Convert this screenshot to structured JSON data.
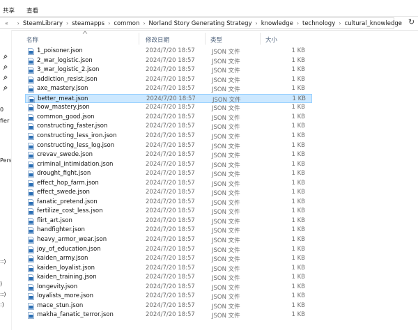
{
  "ribbon": {
    "tabs": [
      "共享",
      "查看"
    ]
  },
  "address": {
    "crumbs": [
      "SteamLibrary",
      "steamapps",
      "common",
      "Norland Story Generating Strategy",
      "knowledge",
      "technology",
      "cultural_knowledge"
    ],
    "lead_glyph": "«",
    "sep_glyph": "›",
    "dropdown_glyph": "⌄",
    "refresh_glyph": "↻"
  },
  "nav_fragments": [
    "0",
    "fier",
    "Perso",
    "::)",
    ")",
    "::)",
    ":)"
  ],
  "columns": {
    "name": "名称",
    "date": "修改日期",
    "type": "类型",
    "size": "大小"
  },
  "files": [
    {
      "name": "1_poisoner.json",
      "date": "2024/7/20 18:57",
      "type": "JSON 文件",
      "size": "1 KB"
    },
    {
      "name": "2_war_logistic.json",
      "date": "2024/7/20 18:57",
      "type": "JSON 文件",
      "size": "1 KB"
    },
    {
      "name": "3_war_logistic_2.json",
      "date": "2024/7/20 18:57",
      "type": "JSON 文件",
      "size": "1 KB"
    },
    {
      "name": "addiction_resist.json",
      "date": "2024/7/20 18:57",
      "type": "JSON 文件",
      "size": "1 KB"
    },
    {
      "name": "axe_mastery.json",
      "date": "2024/7/20 18:57",
      "type": "JSON 文件",
      "size": "1 KB"
    },
    {
      "name": "better_meat.json",
      "date": "2024/7/20 18:57",
      "type": "JSON 文件",
      "size": "1 KB",
      "selected": true
    },
    {
      "name": "bow_mastery.json",
      "date": "2024/7/20 18:57",
      "type": "JSON 文件",
      "size": "1 KB"
    },
    {
      "name": "common_good.json",
      "date": "2024/7/20 18:57",
      "type": "JSON 文件",
      "size": "1 KB"
    },
    {
      "name": "constructing_faster.json",
      "date": "2024/7/20 18:57",
      "type": "JSON 文件",
      "size": "1 KB"
    },
    {
      "name": "constructing_less_iron.json",
      "date": "2024/7/20 18:57",
      "type": "JSON 文件",
      "size": "1 KB"
    },
    {
      "name": "constructing_less_log.json",
      "date": "2024/7/20 18:57",
      "type": "JSON 文件",
      "size": "1 KB"
    },
    {
      "name": "crevav_swede.json",
      "date": "2024/7/20 18:57",
      "type": "JSON 文件",
      "size": "1 KB"
    },
    {
      "name": "criminal_intimidation.json",
      "date": "2024/7/20 18:57",
      "type": "JSON 文件",
      "size": "1 KB"
    },
    {
      "name": "drought_fight.json",
      "date": "2024/7/20 18:57",
      "type": "JSON 文件",
      "size": "1 KB"
    },
    {
      "name": "effect_hop_farm.json",
      "date": "2024/7/20 18:57",
      "type": "JSON 文件",
      "size": "1 KB"
    },
    {
      "name": "effect_swede.json",
      "date": "2024/7/20 18:57",
      "type": "JSON 文件",
      "size": "1 KB"
    },
    {
      "name": "fanatic_pretend.json",
      "date": "2024/7/20 18:57",
      "type": "JSON 文件",
      "size": "1 KB"
    },
    {
      "name": "fertilize_cost_less.json",
      "date": "2024/7/20 18:57",
      "type": "JSON 文件",
      "size": "1 KB"
    },
    {
      "name": "flirt_art.json",
      "date": "2024/7/20 18:57",
      "type": "JSON 文件",
      "size": "1 KB"
    },
    {
      "name": "handfighter.json",
      "date": "2024/7/20 18:57",
      "type": "JSON 文件",
      "size": "1 KB"
    },
    {
      "name": "heavy_armor_wear.json",
      "date": "2024/7/20 18:57",
      "type": "JSON 文件",
      "size": "1 KB"
    },
    {
      "name": "joy_of_education.json",
      "date": "2024/7/20 18:57",
      "type": "JSON 文件",
      "size": "1 KB"
    },
    {
      "name": "kaiden_army.json",
      "date": "2024/7/20 18:57",
      "type": "JSON 文件",
      "size": "1 KB"
    },
    {
      "name": "kaiden_loyalist.json",
      "date": "2024/7/20 18:57",
      "type": "JSON 文件",
      "size": "1 KB"
    },
    {
      "name": "kaiden_training.json",
      "date": "2024/7/20 18:57",
      "type": "JSON 文件",
      "size": "1 KB"
    },
    {
      "name": "longevity.json",
      "date": "2024/7/20 18:57",
      "type": "JSON 文件",
      "size": "1 KB"
    },
    {
      "name": "loyalists_more.json",
      "date": "2024/7/20 18:57",
      "type": "JSON 文件",
      "size": "1 KB"
    },
    {
      "name": "mace_stun.json",
      "date": "2024/7/20 18:57",
      "type": "JSON 文件",
      "size": "1 KB"
    },
    {
      "name": "makha_fanatic_terror.json",
      "date": "2024/7/20 18:57",
      "type": "JSON 文件",
      "size": "1 KB"
    }
  ],
  "colors": {
    "selection": "#cce8ff",
    "selection_border": "#99d1ff",
    "header_text": "#4c607a",
    "file_icon": "#2b6fb5"
  },
  "icons": {
    "file": "json-file-icon",
    "pin": "pin-icon",
    "refresh": "refresh-icon",
    "dropdown": "chevron-down-icon"
  }
}
